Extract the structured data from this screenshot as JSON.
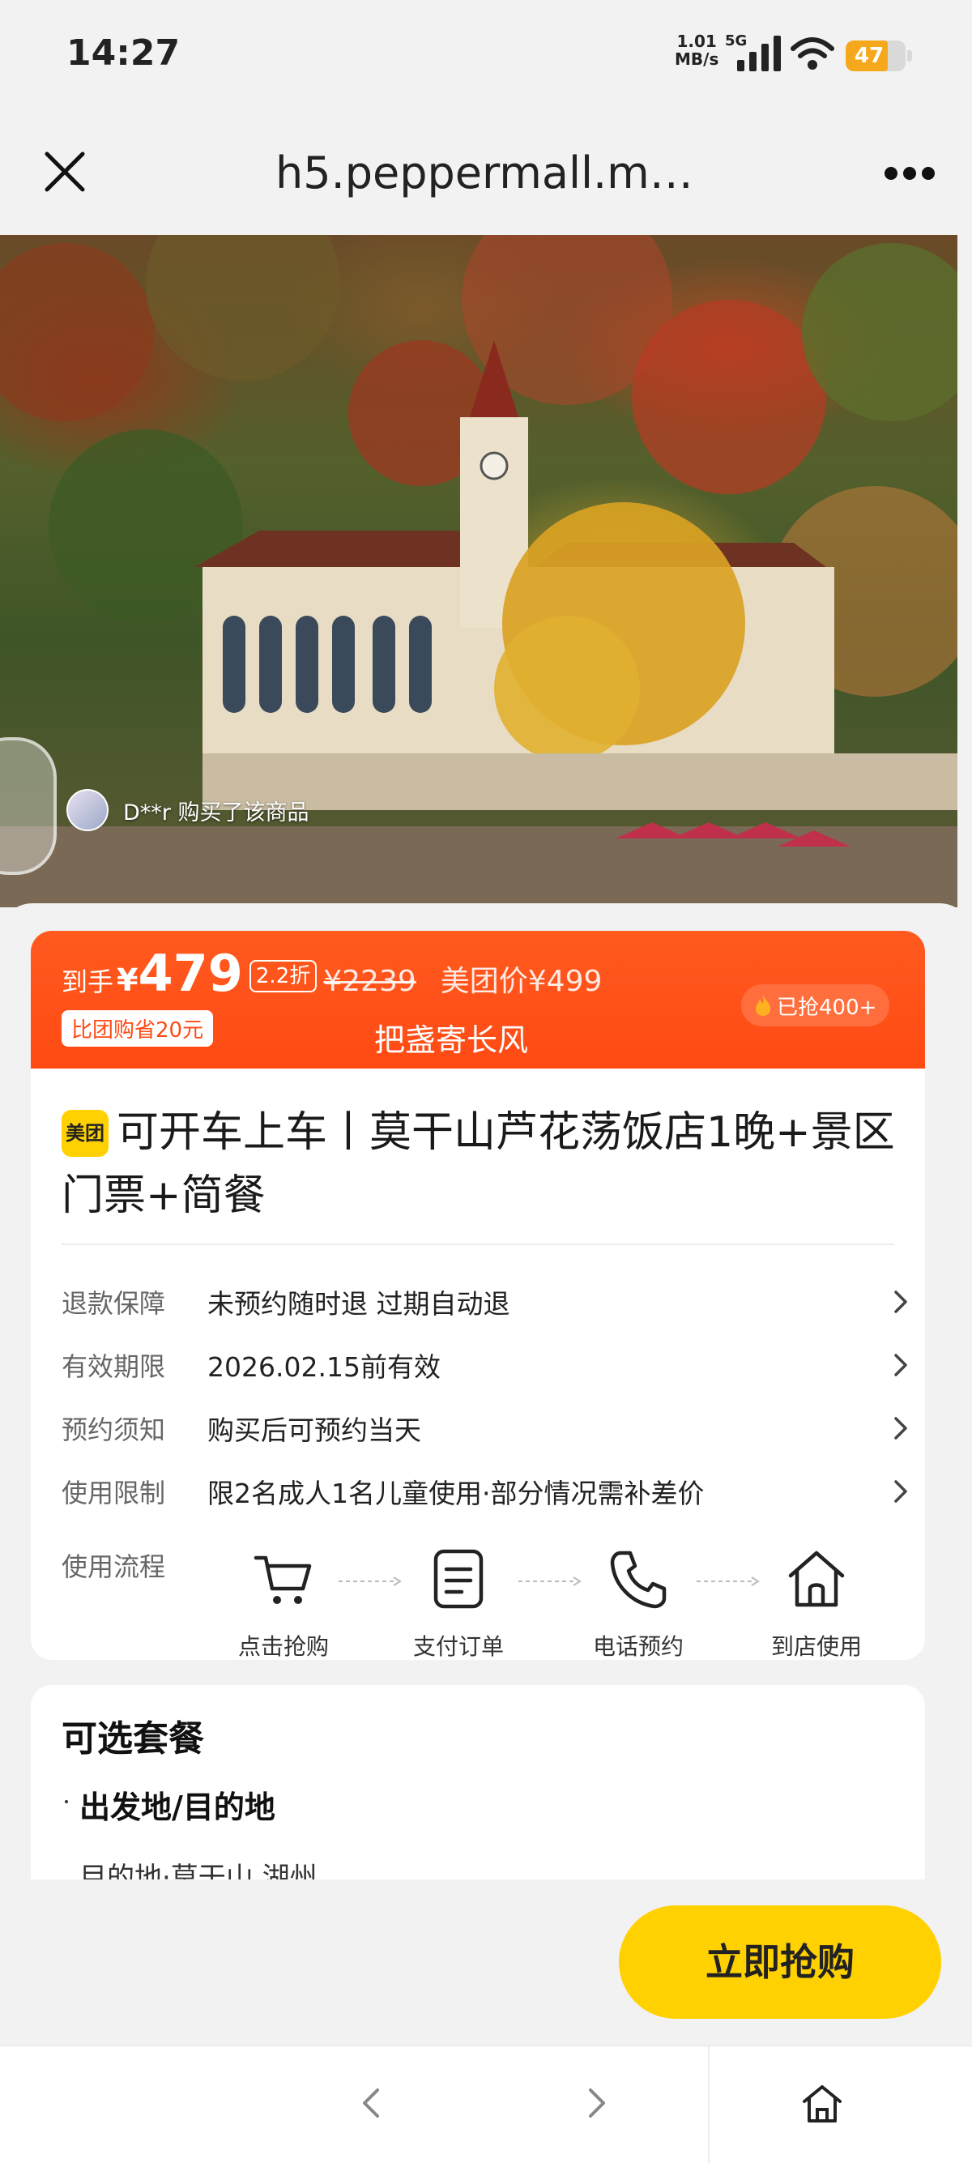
{
  "status_bar": {
    "time": "14:27",
    "net_speed": "1.01",
    "net_unit": "MB/s",
    "network_type": "5G",
    "battery_level": "47",
    "battery_color": "#f6a81c"
  },
  "header": {
    "url": "h5.peppermall.m…",
    "close_icon": "close-icon",
    "more_icon": "more-icon"
  },
  "hero": {
    "buyer_notice": "D**r 购买了该商品"
  },
  "price": {
    "final_label": "到手",
    "currency": "¥",
    "final_amount": "479",
    "discount": "2.2折",
    "original": "¥2239",
    "meituan_price": "美团价¥499",
    "save_badge": "比团购省20元",
    "slogan": "把盏寄长风",
    "sold": "已抢400+",
    "accent_color": "#ff4a14"
  },
  "product": {
    "brand_badge": "美团",
    "title": "可开车上车丨莫干山芦花荡饭店1晚+景区门票+简餐"
  },
  "info_rows": [
    {
      "key": "退款保障",
      "value": "未预约随时退 过期自动退"
    },
    {
      "key": "有效期限",
      "value": "2026.02.15前有效"
    },
    {
      "key": "预约须知",
      "value": "购买后可预约当天"
    },
    {
      "key": "使用限制",
      "value": "限2名成人1名儿童使用·部分情况需补差价"
    }
  ],
  "flow": {
    "label": "使用流程",
    "steps": [
      {
        "icon": "cart-icon",
        "label": "点击抢购"
      },
      {
        "icon": "document-icon",
        "label": "支付订单"
      },
      {
        "icon": "phone-icon",
        "label": "电话预约"
      },
      {
        "icon": "home-icon",
        "label": "到店使用"
      }
    ]
  },
  "packages": {
    "heading": "可选套餐",
    "subheading": "出发地/目的地",
    "destination": "目的地·莫干山 湖州"
  },
  "buy_button": {
    "label": "立即抢购",
    "color": "#ffd100"
  }
}
